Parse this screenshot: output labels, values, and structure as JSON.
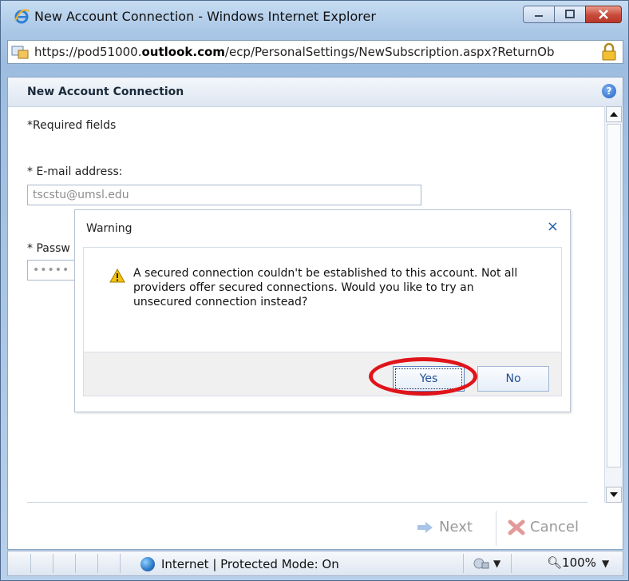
{
  "window": {
    "title": "New Account Connection - Windows Internet Explorer",
    "url_prefix": "https://pod51000.",
    "url_domain": "outlook.com",
    "url_suffix": "/ecp/PersonalSettings/NewSubscription.aspx?ReturnOb"
  },
  "page": {
    "title": "New Account Connection",
    "required_note": "*Required fields",
    "email_label": "* E-mail address:",
    "email_value": "tscstu@umsl.edu",
    "password_label": "* Passw",
    "password_value": "•••••"
  },
  "footer": {
    "next_label": "Next",
    "cancel_label": "Cancel"
  },
  "dialog": {
    "title": "Warning",
    "close": "×",
    "message": "A secured connection couldn't be established to this account. Not all providers offer secured connections. Would you like to try an unsecured connection instead?",
    "yes_label": "Yes",
    "no_label": "No"
  },
  "status": {
    "zone": "Internet | Protected Mode: On",
    "zoom": "100%"
  },
  "colors": {
    "highlight_ring": "#e0141a",
    "link_blue": "#1f4f95"
  }
}
